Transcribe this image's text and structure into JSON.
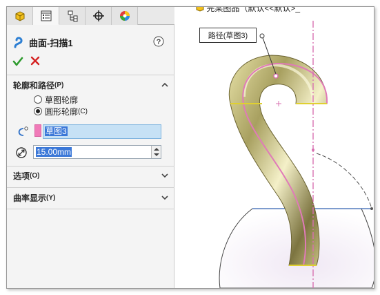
{
  "tabs": [
    {
      "icon": "feature-manager-icon"
    },
    {
      "icon": "property-manager-icon"
    },
    {
      "icon": "configuration-manager-icon"
    },
    {
      "icon": "dimxpert-icon"
    },
    {
      "icon": "display-manager-icon"
    }
  ],
  "feature": {
    "title": "曲面-扫描1",
    "help_icon": "help-icon",
    "ok_icon": "checkmark-icon",
    "cancel_icon": "close-icon"
  },
  "profile_path": {
    "header": "轮廓和路径",
    "header_key": "(P)",
    "options": [
      {
        "label": "草图轮廓",
        "selected": false
      },
      {
        "label": "圆形轮廓",
        "key": "(C)",
        "selected": true
      }
    ],
    "path_selection": "草图3",
    "diameter": "15.00mm"
  },
  "sections": [
    {
      "label": "选项",
      "key": "(O)"
    },
    {
      "label": "曲率显示",
      "key": "(Y)"
    }
  ],
  "viewport": {
    "breadcrumb": "完某图品（默认<<默认>_",
    "callout": "路径(草图3)"
  },
  "colors": {
    "path_line": "#e07ab8",
    "swatch": "#f07ab8",
    "confirm": "#2e9b2e",
    "cancel": "#d42020",
    "accent": "#3b78d8"
  }
}
